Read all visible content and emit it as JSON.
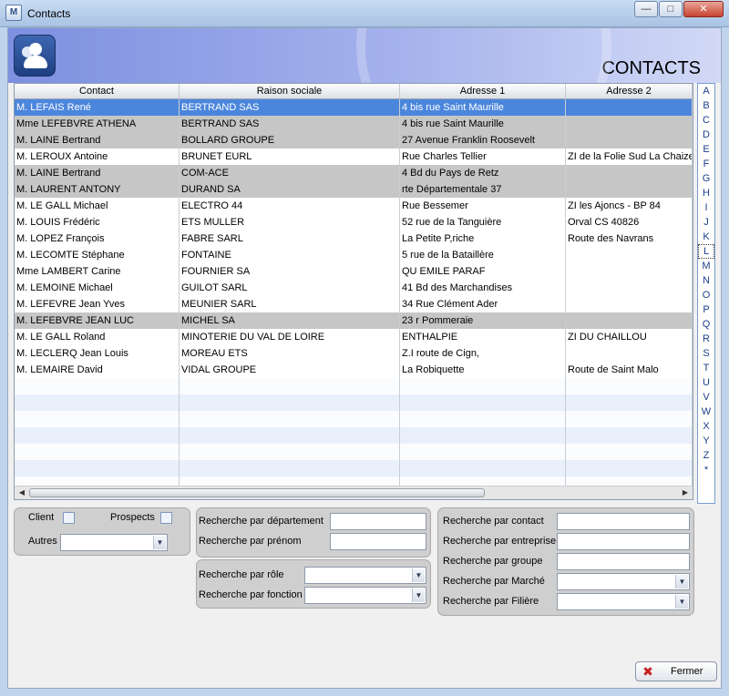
{
  "window": {
    "title": "Contacts",
    "app_icon_text": "M"
  },
  "header": {
    "title": "CONTACTS"
  },
  "grid": {
    "columns": [
      "Contact",
      "Raison sociale",
      "Adresse 1",
      "Adresse 2"
    ],
    "rows": [
      {
        "style": "sel",
        "cells": [
          "M. LEFAIS René",
          "BERTRAND SAS",
          "4 bis rue Saint Maurille",
          ""
        ]
      },
      {
        "style": "gray",
        "cells": [
          "Mme LEFEBVRE ATHENA",
          "BERTRAND SAS",
          "4 bis rue Saint Maurille",
          ""
        ]
      },
      {
        "style": "gray",
        "cells": [
          "M. LAINE Bertrand",
          "BOLLARD GROUPE",
          "27 Avenue Franklin Roosevelt",
          ""
        ]
      },
      {
        "style": "white",
        "cells": [
          "M. LEROUX Antoine",
          "BRUNET EURL",
          "Rue Charles Tellier",
          "ZI de la Folie Sud  La Chaize"
        ]
      },
      {
        "style": "gray",
        "cells": [
          "M. LAINE Bertrand",
          "COM-ACE",
          "4 Bd du Pays de Retz",
          ""
        ]
      },
      {
        "style": "gray",
        "cells": [
          "M. LAURENT ANTONY",
          "DURAND SA",
          "rte Départementale 37",
          ""
        ]
      },
      {
        "style": "white",
        "cells": [
          "M. LE GALL Michael",
          "ELECTRO 44",
          "Rue Bessemer",
          "ZI les Ajoncs - BP 84"
        ]
      },
      {
        "style": "white",
        "cells": [
          "M. LOUIS Frédéric",
          "ETS MULLER",
          "52 rue de la Tanguière",
          "Orval CS 40826"
        ]
      },
      {
        "style": "white",
        "cells": [
          "M. LOPEZ François",
          "FABRE SARL",
          "La Petite P,riche",
          "Route des Navrans"
        ]
      },
      {
        "style": "white",
        "cells": [
          "M. LECOMTE Stéphane",
          "FONTAINE",
          "5 rue de la Bataillère",
          ""
        ]
      },
      {
        "style": "white",
        "cells": [
          "Mme LAMBERT Carine",
          "FOURNIER SA",
          "QU EMILE PARAF",
          ""
        ]
      },
      {
        "style": "white",
        "cells": [
          "M. LEMOINE Michael",
          "GUILOT SARL",
          "41 Bd des Marchandises",
          ""
        ]
      },
      {
        "style": "white",
        "cells": [
          "M. LEFEVRE Jean Yves",
          "MEUNIER SARL",
          "34 Rue Clément Ader",
          ""
        ]
      },
      {
        "style": "gray",
        "cells": [
          "M. LEFEBVRE JEAN LUC",
          "MICHEL SA",
          "23 r Pommeraie",
          ""
        ]
      },
      {
        "style": "white",
        "cells": [
          "M. LE GALL Roland",
          "MINOTERIE DU VAL DE LOIRE",
          "ENTHALPIE",
          "ZI DU CHAILLOU"
        ]
      },
      {
        "style": "white",
        "cells": [
          "M. LECLERQ Jean Louis",
          "MOREAU ETS",
          "Z.I route de Cign,",
          ""
        ]
      },
      {
        "style": "white",
        "cells": [
          "M. LEMAIRE David",
          "VIDAL GROUPE",
          "La Robiquette",
          "Route de Saint Malo"
        ]
      }
    ]
  },
  "alphabet": [
    "A",
    "B",
    "C",
    "D",
    "E",
    "F",
    "G",
    "H",
    "I",
    "J",
    "K",
    "L",
    "M",
    "N",
    "O",
    "P",
    "Q",
    "R",
    "S",
    "T",
    "U",
    "V",
    "W",
    "X",
    "Y",
    "Z",
    "*"
  ],
  "alphabet_selected": "L",
  "filters": {
    "client_label": "Client",
    "prospects_label": "Prospects",
    "autres_label": "Autres",
    "autres_value": "",
    "departement_label": "Recherche par département",
    "prenom_label": "Recherche par prénom",
    "role_label": "Recherche par rôle",
    "fonction_label": "Recherche par fonction",
    "contact_label": "Recherche par contact",
    "entreprise_label": "Recherche par entreprise",
    "groupe_label": "Recherche par groupe",
    "marche_label": "Recherche par Marché",
    "filiere_label": "Recherche par Filière"
  },
  "buttons": {
    "fermer": "Fermer"
  }
}
